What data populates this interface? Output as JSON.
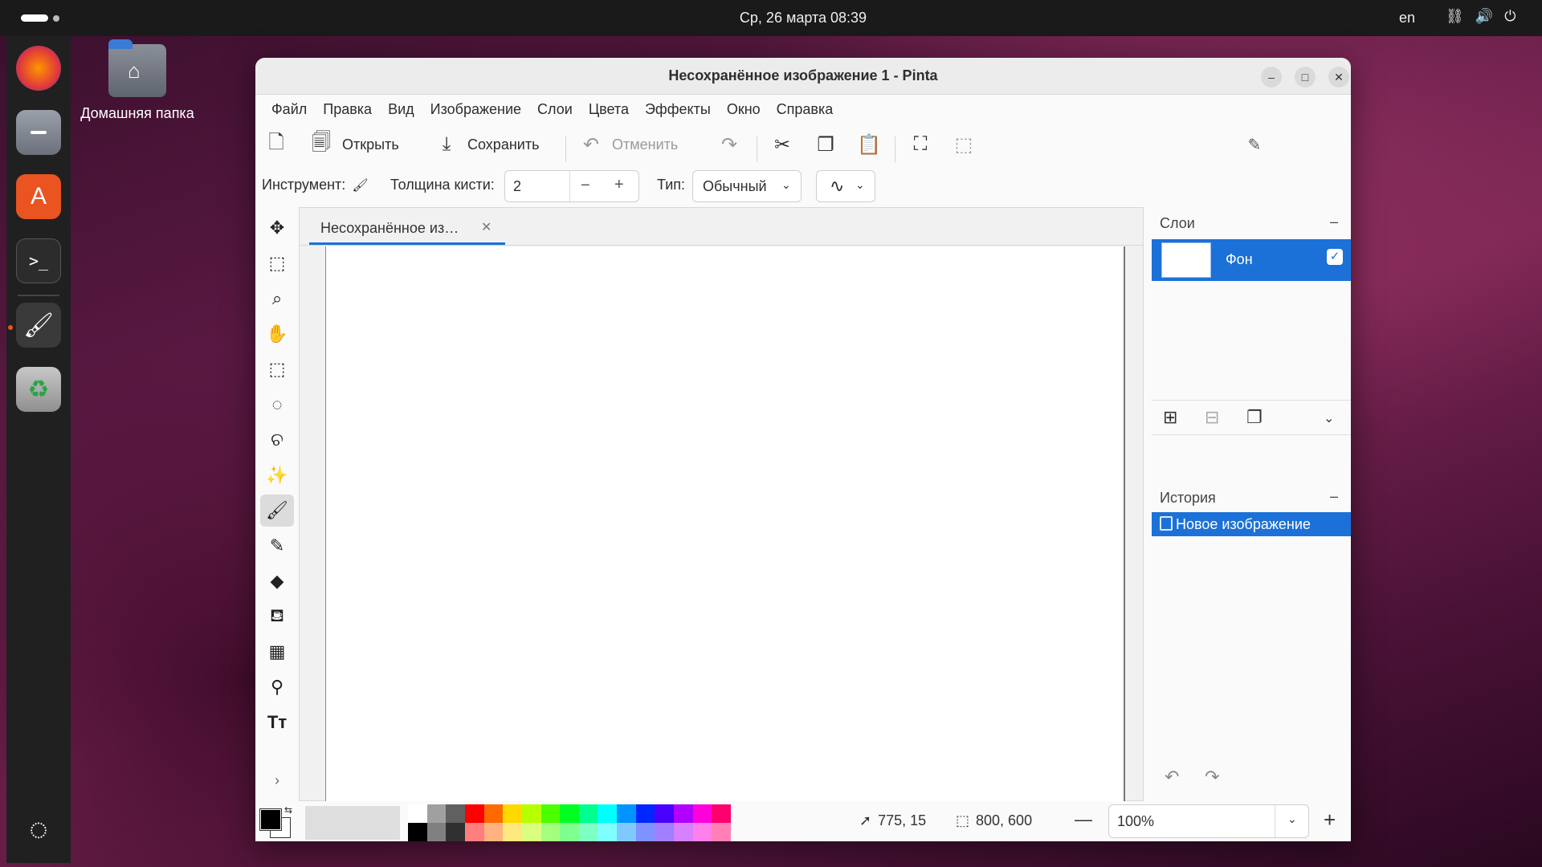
{
  "topbar": {
    "datetime": "Ср, 26 марта  08:39",
    "language": "en",
    "icons": [
      "network-icon",
      "volume-icon",
      "power-icon"
    ]
  },
  "dock": {
    "apps": [
      "firefox-icon",
      "files-icon",
      "app-center-icon",
      "terminal-icon",
      "pinta-icon",
      "trash-icon",
      "show-apps-icon"
    ]
  },
  "desktop": {
    "home_folder_label": "Домашняя папка"
  },
  "window": {
    "title": "Несохранённое изображение 1 - Pinta"
  },
  "menu": [
    "Файл",
    "Правка",
    "Вид",
    "Изображение",
    "Слои",
    "Цвета",
    "Эффекты",
    "Окно",
    "Справка"
  ],
  "toolbar": {
    "open_label": "Открыть",
    "save_label": "Сохранить",
    "undo_label": "Отменить"
  },
  "options": {
    "tool_label": "Инструмент:",
    "brush_width_label": "Толщина кисти:",
    "brush_width_value": "2",
    "type_label": "Тип:",
    "type_value": "Обычный"
  },
  "document": {
    "tab_label": "Несохранённое из…"
  },
  "layers": {
    "header": "Слои",
    "items": [
      {
        "name": "Фон",
        "visible": true
      }
    ]
  },
  "history": {
    "header": "История",
    "items": [
      "Новое изображение"
    ]
  },
  "status": {
    "cursor_position": "775, 15",
    "image_size": "800, 600",
    "zoom": "100%"
  },
  "palette": {
    "top": [
      "#ffffff",
      "#a0a0a0",
      "#606060",
      "#ff0000",
      "#ff6a00",
      "#ffd800",
      "#b6ff00",
      "#4cff00",
      "#00ff21",
      "#00ff90",
      "#00ffff",
      "#0094ff",
      "#0026ff",
      "#4800ff",
      "#b200ff",
      "#ff00dc",
      "#ff006e"
    ],
    "bottom": [
      "#000000",
      "#808080",
      "#303030",
      "#ff7f7f",
      "#ffb27f",
      "#ffe97f",
      "#daff7f",
      "#a5ff7f",
      "#7fff8e",
      "#7fffc5",
      "#7fffff",
      "#7fc9ff",
      "#7f92ff",
      "#a17fff",
      "#d67fff",
      "#ff7fed",
      "#ff7fb6"
    ],
    "primary": "#000000",
    "secondary": "#ffffff"
  },
  "colors": {
    "accent": "#1c71d8",
    "ubuntu_orange": "#e95420"
  }
}
